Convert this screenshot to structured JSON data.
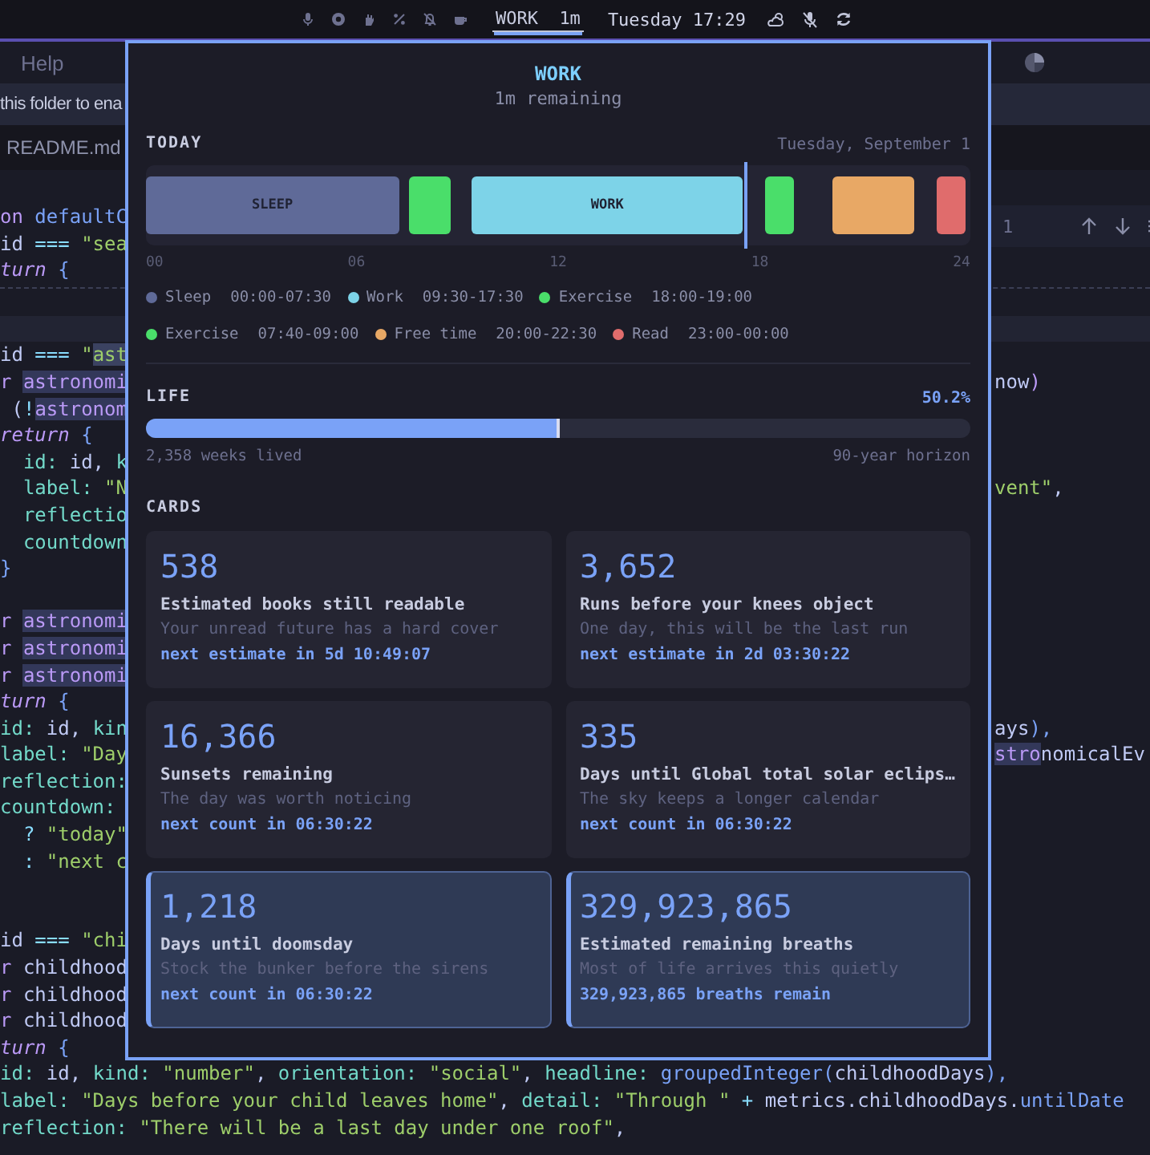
{
  "top_bar": {
    "status": {
      "label": "WORK",
      "time": "1m"
    },
    "clock": "Tuesday 17:29"
  },
  "menu_bar": {
    "items": [
      "Help"
    ]
  },
  "notification": {
    "text": "this folder to ena"
  },
  "editor_tab": {
    "label": "README.md"
  },
  "find_widget": {
    "count": "1"
  },
  "editor": {
    "sticky_lines": [
      {
        "kind": "code",
        "left": [
          {
            "text": "on",
            "kind": "kw"
          },
          {
            "text": " defaultC",
            "kind": "fn"
          }
        ]
      },
      {
        "kind": "code",
        "left": [
          {
            "text": "id",
            "kind": "plain"
          },
          {
            "text": " === ",
            "kind": "op"
          },
          {
            "text": "\"sea",
            "kind": "str"
          }
        ]
      },
      {
        "kind": "code",
        "left": [
          {
            "text": "turn",
            "kind": "kw-italic"
          },
          {
            "text": " {",
            "kind": "punct"
          }
        ]
      }
    ],
    "lines": [
      {
        "kind": "current"
      },
      {
        "kind": "code",
        "left": [
          {
            "text": "id",
            "kind": "plain"
          },
          {
            "text": " === ",
            "kind": "op"
          },
          {
            "text": "\"",
            "kind": "str"
          },
          {
            "text": "ast",
            "kind": "str-match"
          }
        ]
      },
      {
        "kind": "code",
        "left": [
          {
            "text": "r ",
            "kind": "kw"
          },
          {
            "text": "astronomi",
            "kind": "var-match"
          }
        ],
        "right": [
          {
            "text": "now",
            "kind": "plain"
          },
          {
            "text": ")",
            "kind": "kw"
          }
        ]
      },
      {
        "kind": "code",
        "left": [
          {
            "text": " (",
            "kind": "plain"
          },
          {
            "text": "!",
            "kind": "op"
          },
          {
            "text": "astronom",
            "kind": "var-match"
          }
        ]
      },
      {
        "kind": "code",
        "left": [
          {
            "text": "return",
            "kind": "kw-italic"
          },
          {
            "text": " {",
            "kind": "punct"
          }
        ]
      },
      {
        "kind": "code",
        "left": [
          {
            "text": "  id:",
            "kind": "prop"
          },
          {
            "text": " id, ",
            "kind": "plain"
          },
          {
            "text": "k",
            "kind": "prop"
          }
        ]
      },
      {
        "kind": "code",
        "left": [
          {
            "text": "  label:",
            "kind": "prop"
          },
          {
            "text": " \"N",
            "kind": "str"
          }
        ],
        "right": [
          {
            "text": "vent\"",
            "kind": "str"
          },
          {
            "text": ",",
            "kind": "plain"
          }
        ]
      },
      {
        "kind": "code",
        "left": [
          {
            "text": "  reflectio",
            "kind": "prop"
          }
        ]
      },
      {
        "kind": "code",
        "left": [
          {
            "text": "  countdown",
            "kind": "prop"
          }
        ]
      },
      {
        "kind": "code",
        "left": [
          {
            "text": "}",
            "kind": "punct"
          }
        ]
      },
      {
        "kind": "blank"
      },
      {
        "kind": "code",
        "left": [
          {
            "text": "r ",
            "kind": "kw"
          },
          {
            "text": "astronomi",
            "kind": "var-match"
          }
        ]
      },
      {
        "kind": "code",
        "left": [
          {
            "text": "r ",
            "kind": "kw"
          },
          {
            "text": "astronomi",
            "kind": "var-match"
          }
        ]
      },
      {
        "kind": "code",
        "left": [
          {
            "text": "r ",
            "kind": "kw"
          },
          {
            "text": "astronomi",
            "kind": "var-match"
          }
        ]
      },
      {
        "kind": "code",
        "left": [
          {
            "text": "turn",
            "kind": "kw-italic"
          },
          {
            "text": " {",
            "kind": "punct"
          }
        ]
      },
      {
        "kind": "code",
        "left": [
          {
            "text": "id:",
            "kind": "prop"
          },
          {
            "text": " id, ",
            "kind": "plain"
          },
          {
            "text": "kin",
            "kind": "prop"
          }
        ],
        "right": [
          {
            "text": "ays",
            "kind": "plain"
          },
          {
            "text": "),",
            "kind": "punct"
          }
        ]
      },
      {
        "kind": "code",
        "left": [
          {
            "text": "label:",
            "kind": "prop"
          },
          {
            "text": " \"Day",
            "kind": "str"
          }
        ],
        "right": [
          {
            "text": "stro",
            "kind": "var-match"
          },
          {
            "text": "nomicalEv",
            "kind": "plain"
          }
        ]
      },
      {
        "kind": "code",
        "left": [
          {
            "text": "reflection:",
            "kind": "prop"
          }
        ]
      },
      {
        "kind": "code",
        "left": [
          {
            "text": "countdown:",
            "kind": "prop"
          }
        ]
      },
      {
        "kind": "code",
        "left": [
          {
            "text": "  ? ",
            "kind": "op"
          },
          {
            "text": "\"today\"",
            "kind": "str"
          }
        ]
      },
      {
        "kind": "code",
        "left": [
          {
            "text": "  : ",
            "kind": "op"
          },
          {
            "text": "\"next c",
            "kind": "str"
          }
        ]
      },
      {
        "kind": "blank"
      },
      {
        "kind": "blank"
      },
      {
        "kind": "code",
        "left": [
          {
            "text": "id",
            "kind": "plain"
          },
          {
            "text": " === ",
            "kind": "op"
          },
          {
            "text": "\"chi",
            "kind": "str"
          }
        ]
      },
      {
        "kind": "code",
        "left": [
          {
            "text": "r ",
            "kind": "kw"
          },
          {
            "text": "childhood",
            "kind": "plain"
          }
        ]
      },
      {
        "kind": "code",
        "left": [
          {
            "text": "r ",
            "kind": "kw"
          },
          {
            "text": "childhood",
            "kind": "plain"
          }
        ]
      },
      {
        "kind": "code",
        "left": [
          {
            "text": "r ",
            "kind": "kw"
          },
          {
            "text": "childhood",
            "kind": "plain"
          }
        ]
      },
      {
        "kind": "code",
        "left": [
          {
            "text": "turn",
            "kind": "kw-italic"
          },
          {
            "text": " {",
            "kind": "punct"
          }
        ]
      },
      {
        "kind": "code",
        "left": [
          {
            "text": "id:",
            "kind": "prop"
          },
          {
            "text": " id, ",
            "kind": "plain"
          },
          {
            "text": "kind:",
            "kind": "prop"
          },
          {
            "text": " \"number\"",
            "kind": "str"
          },
          {
            "text": ", ",
            "kind": "plain"
          },
          {
            "text": "orientation:",
            "kind": "prop"
          },
          {
            "text": " \"social\"",
            "kind": "str"
          },
          {
            "text": ", ",
            "kind": "plain"
          },
          {
            "text": "headline:",
            "kind": "prop"
          },
          {
            "text": " groupedInteger",
            "kind": "fn"
          },
          {
            "text": "(",
            "kind": "punct"
          },
          {
            "text": "childhoodDays",
            "kind": "plain"
          },
          {
            "text": "),",
            "kind": "punct"
          }
        ]
      },
      {
        "kind": "code",
        "left": [
          {
            "text": "label:",
            "kind": "prop"
          },
          {
            "text": " \"Days before your child leaves home\"",
            "kind": "str"
          },
          {
            "text": ", ",
            "kind": "plain"
          },
          {
            "text": "detail:",
            "kind": "prop"
          },
          {
            "text": " \"Through \"",
            "kind": "str"
          },
          {
            "text": " + ",
            "kind": "op"
          },
          {
            "text": "metrics.childhoodDays.",
            "kind": "plain"
          },
          {
            "text": "untilDate",
            "kind": "fn"
          }
        ]
      },
      {
        "kind": "code",
        "left": [
          {
            "text": "reflection:",
            "kind": "prop"
          },
          {
            "text": " \"There will be a last day under one roof\"",
            "kind": "str"
          },
          {
            "text": ",",
            "kind": "plain"
          }
        ]
      }
    ]
  },
  "popover": {
    "title": "WORK",
    "subtitle": "1m remaining",
    "today": {
      "heading": "TODAY",
      "date": "Tuesday, September 1",
      "now_marker": {
        "level": 0.7285
      },
      "ticks": [
        "00",
        "06",
        "12",
        "18",
        "24"
      ],
      "blocks": [
        {
          "name": "Sleep",
          "range": "00:00-07:30",
          "color": "#5f6a98",
          "bar_label": "SLEEP"
        },
        {
          "name": "Work",
          "range": "09:30-17:30",
          "color": "#7dd3e8",
          "bar_label": "WORK"
        },
        {
          "name": "Exercise",
          "range": "18:00-19:00",
          "color": "#4ade6a"
        },
        {
          "name": "Exercise",
          "range": "07:40-09:00",
          "color": "#4ade6a"
        },
        {
          "name": "Free time",
          "range": "20:00-22:30",
          "color": "#e8a865"
        },
        {
          "name": "Read",
          "range": "23:00-00:00",
          "color": "#e06c6c"
        }
      ]
    },
    "life": {
      "heading": "LIFE",
      "percent": "50.2%",
      "level": 0.502,
      "left_note": "2,358 weeks lived",
      "right_note": "90-year horizon"
    },
    "cards": {
      "heading": "CARDS",
      "items": [
        {
          "value": "538",
          "title": "Estimated books still readable",
          "detail": "Your unread future has a hard cover",
          "footer": "next estimate in 5d 10:49:07",
          "highlighted": false
        },
        {
          "value": "3,652",
          "title": "Runs before your knees object",
          "detail": "One day, this will be the last run",
          "footer": "next estimate in 2d 03:30:22",
          "highlighted": false
        },
        {
          "value": "16,366",
          "title": "Sunsets remaining",
          "detail": "The day was worth noticing",
          "footer": "next count in 06:30:22",
          "highlighted": false
        },
        {
          "value": "335",
          "title": "Days until Global total solar eclips…",
          "detail": "The sky keeps a longer calendar",
          "footer": "next count in 06:30:22",
          "highlighted": false
        },
        {
          "value": "1,218",
          "title": "Days until doomsday",
          "detail": "Stock the bunker before the sirens",
          "footer": "next count in 06:30:22",
          "highlighted": true
        },
        {
          "value": "329,923,865",
          "title": "Estimated remaining breaths",
          "detail": "Most of life arrives this quietly",
          "footer": "329,923,865 breaths remain",
          "highlighted": true
        }
      ]
    }
  }
}
